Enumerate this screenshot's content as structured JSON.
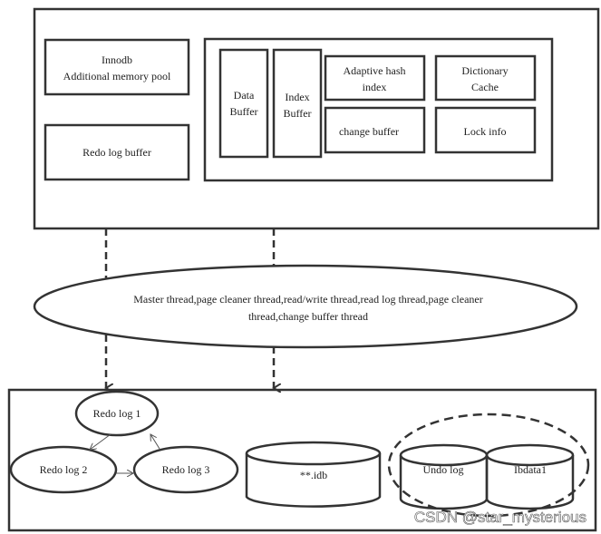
{
  "memory": {
    "additional_pool": [
      "Innodb",
      "Additional memory pool"
    ],
    "redo_log_buffer": "Redo log buffer",
    "data_buffer": [
      "Data",
      "Buffer"
    ],
    "index_buffer": [
      "Index",
      "Buffer"
    ],
    "adaptive_hash": [
      "Adaptive hash",
      "index"
    ],
    "dictionary_cache": [
      "Dictionary",
      "Cache"
    ],
    "change_buffer": "change buffer",
    "lock_info": "Lock info"
  },
  "threads": [
    "Master thread,page cleaner thread,read/write thread,read log thread,page cleaner",
    "thread,change buffer thread"
  ],
  "disk": {
    "redo_log_1": "Redo log 1",
    "redo_log_2": "Redo log 2",
    "redo_log_3": "Redo log 3",
    "idb": "**.idb",
    "undo_log": "Undo log",
    "ibdata": "Ibdata1"
  },
  "watermark": "CSDN @star_mysterious"
}
